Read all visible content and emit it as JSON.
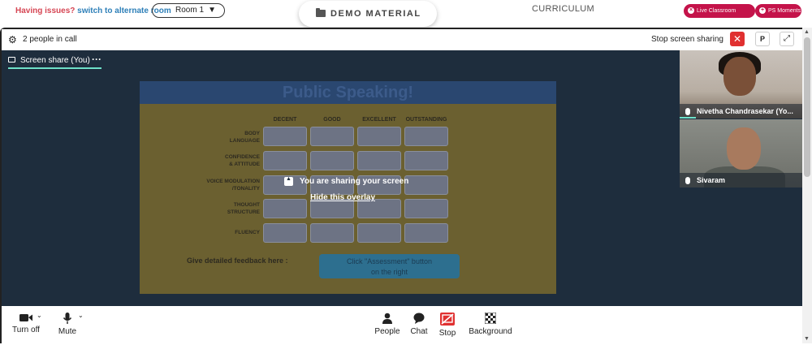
{
  "topbar": {
    "issue_text": "Having issues?",
    "issue_link": "switch to alternate room",
    "room_selected": "Room 1",
    "demo_label": "DEMO MATERIAL",
    "curriculum_label": "CURRICULUM",
    "live_support_label": "Live Classroom Support",
    "ps_moments_label": "PS Moments"
  },
  "call_header": {
    "people_count": "2 people in call",
    "stop_sharing_label": "Stop screen sharing",
    "p_button_label": "P"
  },
  "stage": {
    "tab_label": "Screen share (You)",
    "overlay_message": "You are sharing your screen",
    "hide_overlay_link": "Hide this overlay"
  },
  "slide": {
    "title": "Public Speaking!",
    "columns": [
      "DECENT",
      "GOOD",
      "EXCELLENT",
      "OUTSTANDING"
    ],
    "rows": [
      [
        "BODY",
        "LANGUAGE"
      ],
      [
        "CONFIDENCE",
        "& ATTITUDE"
      ],
      [
        "VOICE MODULATION",
        "/TONALITY"
      ],
      [
        "THOUGHT",
        "STRUCTURE"
      ],
      [
        "FLUENCY"
      ]
    ],
    "feedback_label": "Give detailed feedback here :",
    "assessment_line1": "Click \"Assessment\" button",
    "assessment_line2": "on the right"
  },
  "participants": [
    {
      "name": "Nivetha Chandrasekar (Yo..."
    },
    {
      "name": "Sivaram"
    }
  ],
  "toolbar": {
    "camera_label": "Turn off",
    "mic_label": "Mute",
    "people_label": "People",
    "chat_label": "Chat",
    "stop_label": "Stop",
    "background_label": "Background"
  },
  "colors": {
    "accent_red": "#e03030",
    "support_pink": "#c4134a",
    "stage_bg": "#1e2d3d",
    "speaking_teal": "#6ee0c8"
  }
}
